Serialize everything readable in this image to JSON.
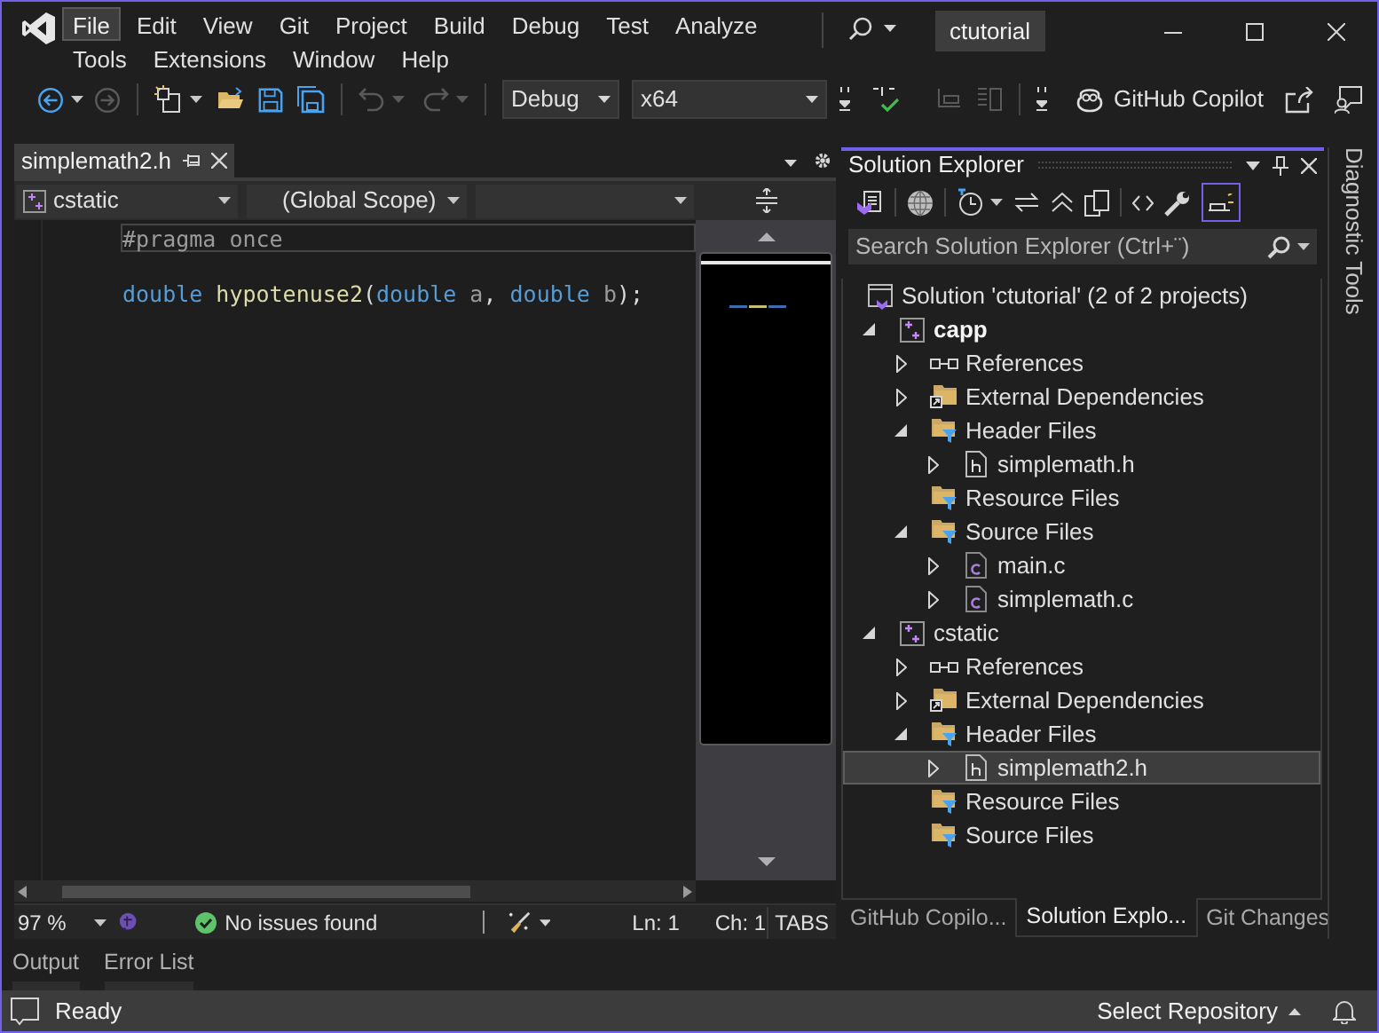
{
  "menu": [
    {
      "label": "File",
      "selected": true
    },
    {
      "label": "Edit",
      "selected": false
    },
    {
      "label": "View",
      "selected": false
    },
    {
      "label": "Git",
      "selected": false
    },
    {
      "label": "Project",
      "selected": false
    },
    {
      "label": "Build",
      "selected": false
    },
    {
      "label": "Debug",
      "selected": false
    },
    {
      "label": "Test",
      "selected": false
    },
    {
      "label": "Analyze",
      "selected": false
    },
    {
      "label": "Tools",
      "selected": false
    },
    {
      "label": "Extensions",
      "selected": false
    },
    {
      "label": "Window",
      "selected": false
    },
    {
      "label": "Help",
      "selected": false
    }
  ],
  "solution_name": "ctutorial",
  "toolbar": {
    "configuration": "Debug",
    "platform": "x64",
    "copilot": "GitHub Copilot"
  },
  "editor": {
    "tab": {
      "title": "simplemath2.h"
    },
    "navigation": {
      "project": "cstatic",
      "scope": "(Global Scope)"
    },
    "lines": [
      {
        "kind": "code",
        "tokens": [
          {
            "kind": "preprocessor",
            "text": "#pragma once"
          }
        ]
      },
      {
        "kind": "blank"
      },
      {
        "kind": "code",
        "tokens": [
          {
            "kind": "keyword",
            "text": "double"
          },
          {
            "kind": "function",
            "text": " hypotenuse2"
          },
          {
            "kind": "plain",
            "text": "("
          },
          {
            "kind": "keyword",
            "text": "double"
          },
          {
            "kind": "param",
            "text": " a"
          },
          {
            "kind": "plain",
            "text": ", "
          },
          {
            "kind": "keyword",
            "text": "double"
          },
          {
            "kind": "param",
            "text": " b"
          },
          {
            "kind": "plain",
            "text": ");"
          }
        ]
      }
    ],
    "status": {
      "zoom": "97 %",
      "issues": "No issues found",
      "line": "Ln: 1",
      "column": "Ch: 1",
      "indent": "TABS"
    }
  },
  "solution_explorer": {
    "title": "Solution Explorer",
    "search": {
      "placeholder": "Search Solution Explorer (Ctrl+¨)"
    },
    "tree": [
      {
        "label": "Solution 'ctutorial' (2 of 2 projects)",
        "kind": "solution",
        "selected": false,
        "children": [
          {
            "label": "capp",
            "kind": "project",
            "startup": true,
            "expanded": true,
            "selected": false,
            "children": [
              {
                "label": "References",
                "kind": "references",
                "expanded": false,
                "selected": false
              },
              {
                "label": "External Dependencies",
                "kind": "external",
                "expanded": false,
                "selected": false
              },
              {
                "label": "Header Files",
                "kind": "folder",
                "expanded": true,
                "selected": false,
                "children": [
                  {
                    "label": "simplemath.h",
                    "kind": "header",
                    "expanded": false,
                    "selected": false
                  }
                ]
              },
              {
                "label": "Resource Files",
                "kind": "folder",
                "selected": false
              },
              {
                "label": "Source Files",
                "kind": "folder",
                "expanded": true,
                "selected": false,
                "children": [
                  {
                    "label": "main.c",
                    "kind": "source",
                    "expanded": false,
                    "selected": false
                  },
                  {
                    "label": "simplemath.c",
                    "kind": "source",
                    "expanded": false,
                    "selected": false
                  }
                ]
              }
            ]
          },
          {
            "label": "cstatic",
            "kind": "project",
            "startup": false,
            "expanded": true,
            "selected": false,
            "children": [
              {
                "label": "References",
                "kind": "references",
                "expanded": false,
                "selected": false
              },
              {
                "label": "External Dependencies",
                "kind": "external",
                "expanded": false,
                "selected": false
              },
              {
                "label": "Header Files",
                "kind": "folder",
                "expanded": true,
                "selected": false,
                "children": [
                  {
                    "label": "simplemath2.h",
                    "kind": "header",
                    "expanded": false,
                    "selected": true
                  }
                ]
              },
              {
                "label": "Resource Files",
                "kind": "folder",
                "selected": false
              },
              {
                "label": "Source Files",
                "kind": "folder",
                "selected": false
              }
            ]
          }
        ]
      }
    ],
    "tabs": [
      {
        "label": "GitHub Copilo...",
        "selected": false
      },
      {
        "label": "Solution Explo...",
        "selected": true
      },
      {
        "label": "Git Changes",
        "selected": false
      }
    ]
  },
  "side_panel": {
    "title": "Diagnostic Tools"
  },
  "bottom_tabs": [
    {
      "label": "Output"
    },
    {
      "label": "Error List"
    }
  ],
  "status_bar": {
    "message": "Ready",
    "repository": "Select Repository"
  }
}
